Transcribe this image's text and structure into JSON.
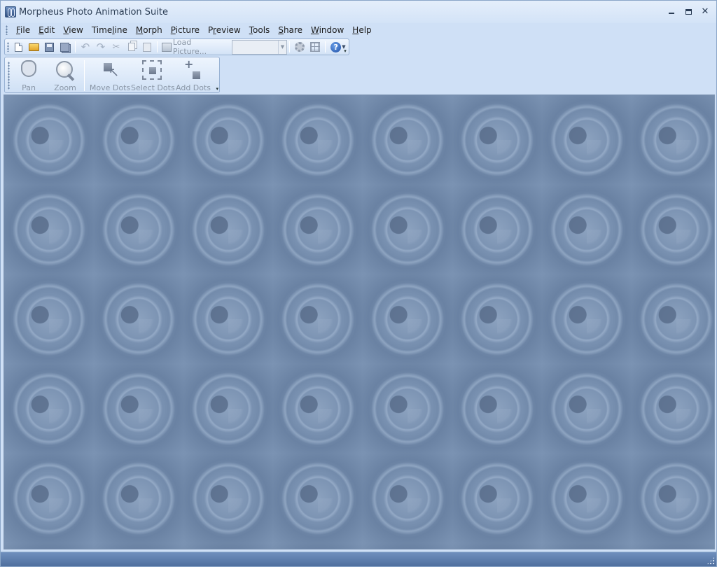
{
  "window": {
    "title": "Morpheus Photo Animation Suite",
    "minimize_glyph": "",
    "maximize_glyph": "",
    "close_glyph": "✕"
  },
  "menu": {
    "items": [
      {
        "accel": "F",
        "rest": "ile"
      },
      {
        "accel": "E",
        "rest": "dit"
      },
      {
        "accel": "V",
        "rest": "iew"
      },
      {
        "accel": "",
        "pre": "Time",
        "accel_mid": "l",
        "rest": "ine"
      },
      {
        "accel": "M",
        "rest": "orph"
      },
      {
        "accel": "P",
        "rest": "icture"
      },
      {
        "accel": "",
        "pre": "P",
        "accel_mid": "r",
        "rest": "eview"
      },
      {
        "accel": "T",
        "rest": "ools"
      },
      {
        "accel": "S",
        "rest": "hare"
      },
      {
        "accel": "W",
        "rest": "indow"
      },
      {
        "accel": "H",
        "rest": "elp"
      }
    ]
  },
  "toolbar": {
    "load_picture_label": "Load Picture...",
    "combo_value": "",
    "cut_glyph": "✂",
    "undo_glyph": "↶",
    "redo_glyph": "↷",
    "help_glyph": "?",
    "dropdown_glyph": "▼",
    "overflow_glyph": "▾"
  },
  "tools": {
    "pan_label": "Pan",
    "zoom_label": "Zoom",
    "move_dots_label": "Move Dots",
    "select_dots_label": "Select Dots",
    "add_dots_label": "Add Dots",
    "overflow_glyph": "▾"
  },
  "colors": {
    "workspace_base": "#6f86a6",
    "statusbar": "#5a7aaa",
    "chrome": "#cfe0f6"
  }
}
